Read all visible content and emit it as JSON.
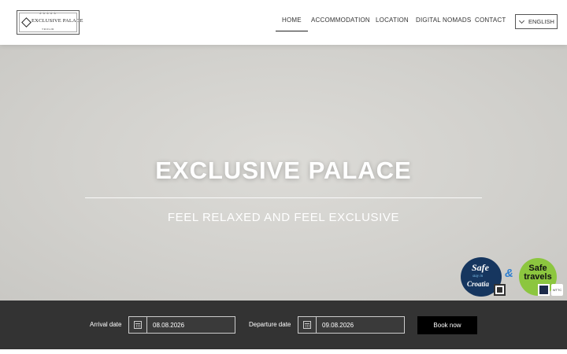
{
  "header": {
    "logo": {
      "stars": "★★★★★",
      "name": "EXCLUSIVE PALACE",
      "city": "TROGIR"
    },
    "nav": [
      {
        "label": "HOME",
        "active": true
      },
      {
        "label": "ACCOMMODATION",
        "active": false
      },
      {
        "label": "LOCATION",
        "active": false
      },
      {
        "label": "DIGITAL NOMADS",
        "active": false
      },
      {
        "label": "CONTACT",
        "active": false
      }
    ],
    "language": "ENGLISH"
  },
  "hero": {
    "title": "EXCLUSIVE PALACE",
    "subtitle": "FEEL RELAXED AND FEEL EXCLUSIVE"
  },
  "badges": {
    "safe_line1": "Safe",
    "safe_line2": "stay in",
    "safe_line3": "Croatia",
    "ampersand": "&",
    "travels_line1": "Safe",
    "travels_line2": "travels",
    "wttc": "WTTC"
  },
  "booking": {
    "arrival_label": "Arrival date",
    "arrival_value": "08.08.2026",
    "departure_label": "Departure date",
    "departure_value": "09.08.2026",
    "button": "Book now"
  }
}
